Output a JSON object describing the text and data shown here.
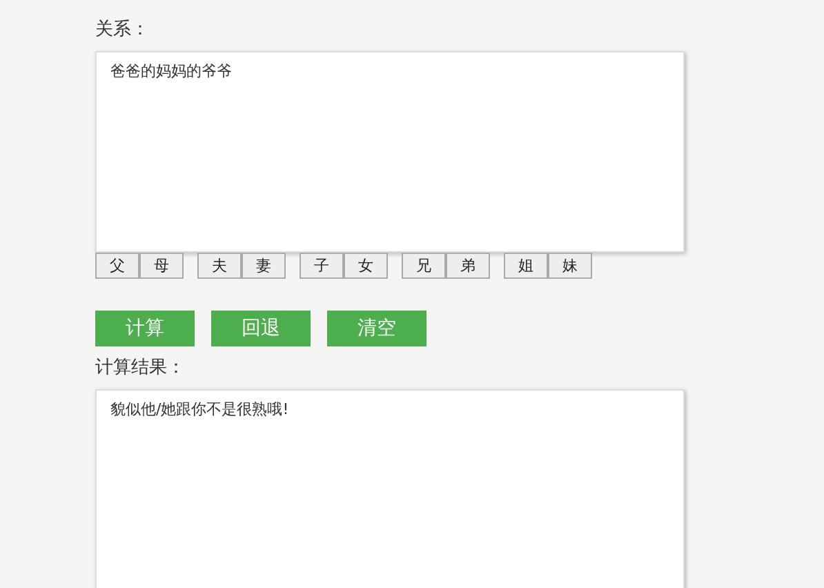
{
  "relation": {
    "label": "关系：",
    "value": "爸爸的妈妈的爷爷"
  },
  "relation_buttons": [
    [
      "父",
      "母"
    ],
    [
      "夫",
      "妻"
    ],
    [
      "子",
      "女"
    ],
    [
      "兄",
      "弟"
    ],
    [
      "姐",
      "妹"
    ]
  ],
  "actions": [
    "计算",
    "回退",
    "清空"
  ],
  "result": {
    "label": "计算结果：",
    "value": "貌似他/她跟你不是很熟哦!"
  }
}
